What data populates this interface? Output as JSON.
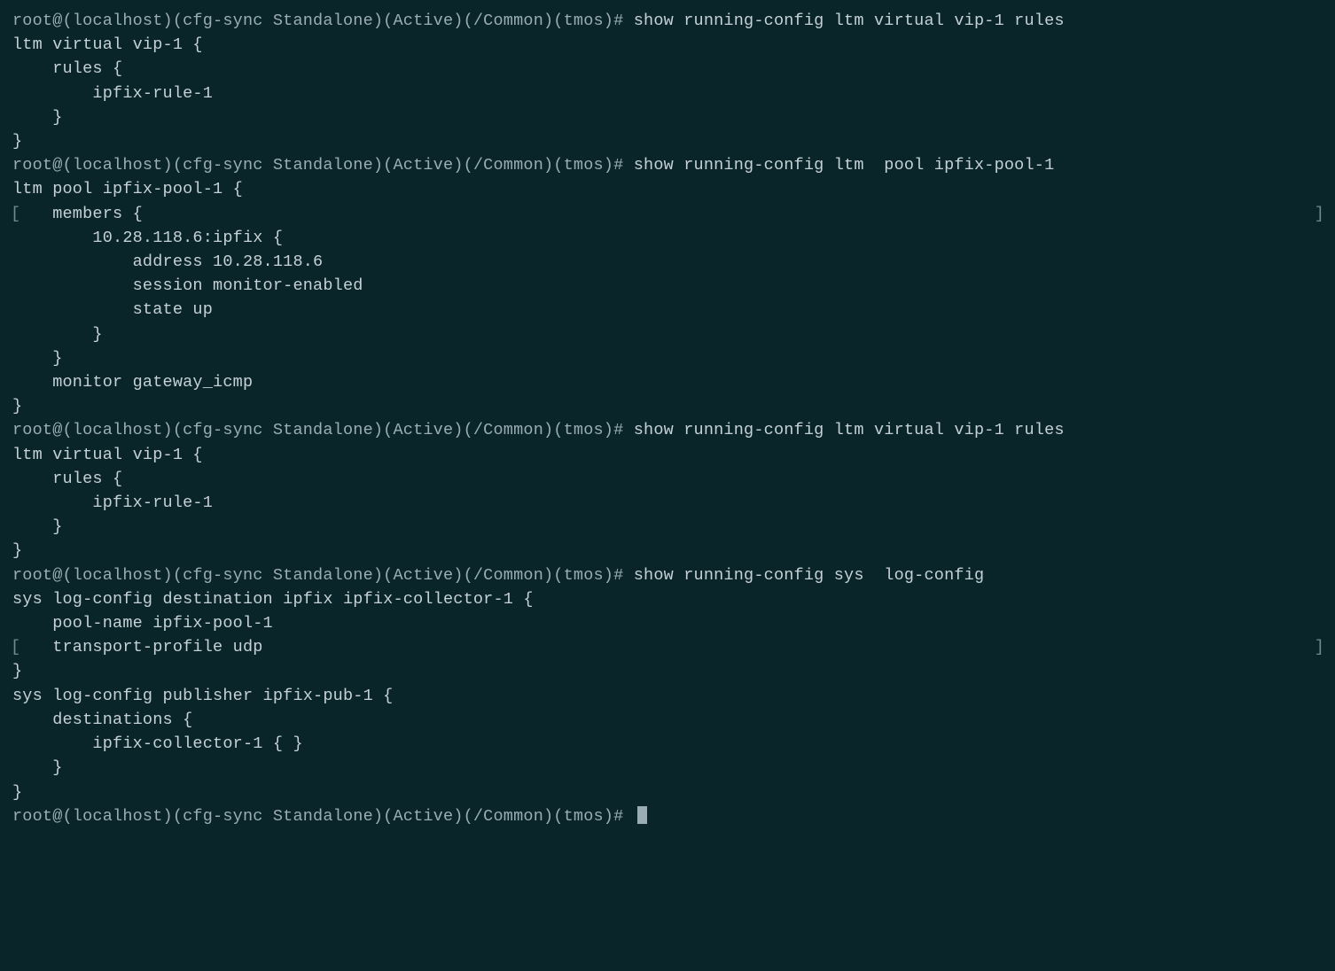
{
  "terminal": {
    "lines": [
      {
        "type": "cmd",
        "prompt": "root@(localhost)(cfg-sync Standalone)(Active)(/Common)(tmos)# ",
        "command": "show running-config ltm virtual vip-1 rules"
      },
      {
        "type": "out",
        "text": "ltm virtual vip-1 {"
      },
      {
        "type": "out",
        "text": "    rules {"
      },
      {
        "type": "out",
        "text": "        ipfix-rule-1"
      },
      {
        "type": "out",
        "text": "    }"
      },
      {
        "type": "out",
        "text": "}"
      },
      {
        "type": "cmd",
        "prompt": "root@(localhost)(cfg-sync Standalone)(Active)(/Common)(tmos)# ",
        "command": "show running-config ltm  pool ipfix-pool-1"
      },
      {
        "type": "out",
        "text": "ltm pool ipfix-pool-1 {"
      },
      {
        "type": "out",
        "text": "    members {",
        "leftBracket": "[",
        "rightBracket": "]"
      },
      {
        "type": "out",
        "text": "        10.28.118.6:ipfix {"
      },
      {
        "type": "out",
        "text": "            address 10.28.118.6"
      },
      {
        "type": "out",
        "text": "            session monitor-enabled"
      },
      {
        "type": "out",
        "text": "            state up"
      },
      {
        "type": "out",
        "text": "        }"
      },
      {
        "type": "out",
        "text": "    }"
      },
      {
        "type": "out",
        "text": "    monitor gateway_icmp"
      },
      {
        "type": "out",
        "text": "}"
      },
      {
        "type": "cmd",
        "prompt": "root@(localhost)(cfg-sync Standalone)(Active)(/Common)(tmos)# ",
        "command": "show running-config ltm virtual vip-1 rules"
      },
      {
        "type": "out",
        "text": "ltm virtual vip-1 {"
      },
      {
        "type": "out",
        "text": "    rules {"
      },
      {
        "type": "out",
        "text": "        ipfix-rule-1"
      },
      {
        "type": "out",
        "text": "    }"
      },
      {
        "type": "out",
        "text": "}"
      },
      {
        "type": "cmd",
        "prompt": "root@(localhost)(cfg-sync Standalone)(Active)(/Common)(tmos)# ",
        "command": "show running-config sys  log-config"
      },
      {
        "type": "out",
        "text": "sys log-config destination ipfix ipfix-collector-1 {"
      },
      {
        "type": "out",
        "text": "    pool-name ipfix-pool-1"
      },
      {
        "type": "out",
        "text": "    transport-profile udp",
        "leftBracket": "[",
        "rightBracket": "]"
      },
      {
        "type": "out",
        "text": "}"
      },
      {
        "type": "out",
        "text": "sys log-config publisher ipfix-pub-1 {"
      },
      {
        "type": "out",
        "text": "    destinations {"
      },
      {
        "type": "out",
        "text": "        ipfix-collector-1 { }"
      },
      {
        "type": "out",
        "text": "    }"
      },
      {
        "type": "out",
        "text": "}"
      },
      {
        "type": "cmd",
        "prompt": "root@(localhost)(cfg-sync Standalone)(Active)(/Common)(tmos)# ",
        "command": "",
        "cursor": true
      }
    ]
  }
}
